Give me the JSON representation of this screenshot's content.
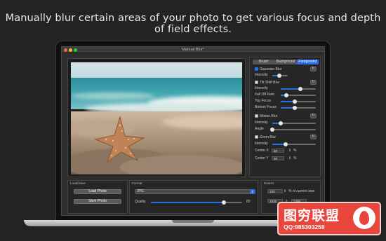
{
  "headline": "Manually blur certain areas of your photo to get various focus and depth of field effects.",
  "window": {
    "title": "Manual Blur*"
  },
  "tabs": [
    {
      "label": "Brush",
      "active": false
    },
    {
      "label": "Background",
      "active": false
    },
    {
      "label": "Foreground",
      "active": true
    }
  ],
  "gaussian": {
    "label": "Gaussian Blur",
    "checked": true,
    "intensity_label": "Intensity",
    "intensity": 0.45
  },
  "tiltshift": {
    "label": "Tilt Shift Blur",
    "checked": false,
    "intensity_label": "Intensity",
    "intensity": 0.55,
    "falloff_label": "Fall Off Rate",
    "falloff": 0.15,
    "top_label": "Top Focus",
    "top": 0.4,
    "bottom_label": "Bottom Focus",
    "bottom": 0.4
  },
  "motion": {
    "label": "Motion Blur",
    "checked": false,
    "intensity_label": "Intensity",
    "intensity": 0.2,
    "angle_label": "Angle",
    "angle": 0.0
  },
  "zoom": {
    "label": "Zoom Blur",
    "checked": false,
    "intensity_label": "Intensity",
    "intensity": 0.3,
    "cx_label": "Center X",
    "cx": "50",
    "cy_label": "Center Y",
    "cy": "50",
    "unit": "%"
  },
  "loadsave": {
    "group": "Load/Save",
    "load": "Load Photo",
    "save": "Save Photo"
  },
  "format": {
    "group": "Format",
    "selected": "JPG",
    "quality_label": "Quality",
    "quality": "80",
    "quality_level": 0.8
  },
  "resize": {
    "group": "Resize",
    "percent": "100",
    "percent_label": "% of current size",
    "width": "1920",
    "x": "x",
    "height": "1280"
  },
  "watermark": {
    "title": "图穷联盟",
    "qq": "QQ:985303259"
  },
  "colors": {
    "accent": "#2a6ee3",
    "watermark": "#e8453c"
  },
  "icons": {
    "reset": "reset-icon",
    "stepper": "stepper-icon",
    "dropdown": "chevron-updown-icon"
  }
}
